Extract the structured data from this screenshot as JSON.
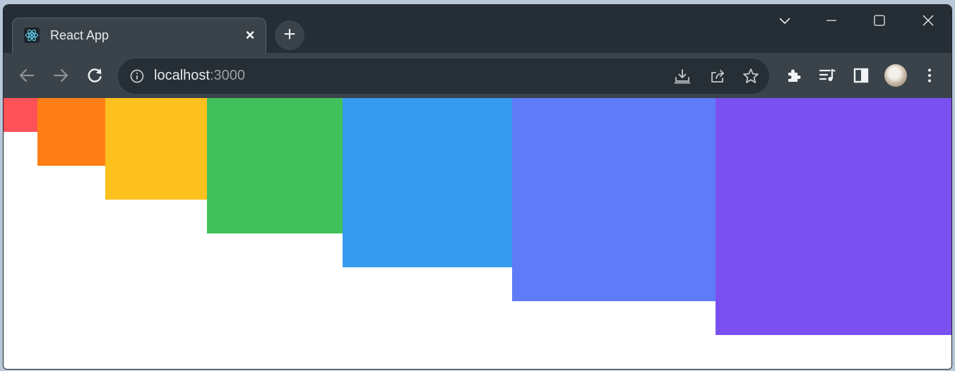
{
  "browser": {
    "tab": {
      "title": "React App",
      "icon": "react-logo-icon",
      "close_label": "×"
    },
    "new_tab_label": "+",
    "url": {
      "host": "localhost",
      "port": ":3000"
    },
    "icons": {
      "back": "arrow-left-icon",
      "forward": "arrow-right-icon",
      "reload": "reload-icon",
      "site_info": "info-icon",
      "install": "install-app-icon",
      "share": "share-icon",
      "bookmark": "star-icon",
      "extensions": "puzzle-icon",
      "media": "playlist-music-icon",
      "side_panel": "side-panel-icon",
      "menu": "kebab-menu-icon",
      "tab_search": "chevron-down-icon",
      "minimize": "minimize-icon",
      "maximize": "maximize-icon",
      "close": "close-icon"
    },
    "theme": {
      "frame": "#252e35",
      "toolbar": "#3a434a",
      "omnibox": "#262f36"
    }
  },
  "page": {
    "boxes": [
      {
        "color": "#ff5158"
      },
      {
        "color": "#ff7f16"
      },
      {
        "color": "#fcc11e"
      },
      {
        "color": "#41c15b"
      },
      {
        "color": "#369aee"
      },
      {
        "color": "#5f7bf7"
      },
      {
        "color": "#7a50f0"
      }
    ]
  }
}
